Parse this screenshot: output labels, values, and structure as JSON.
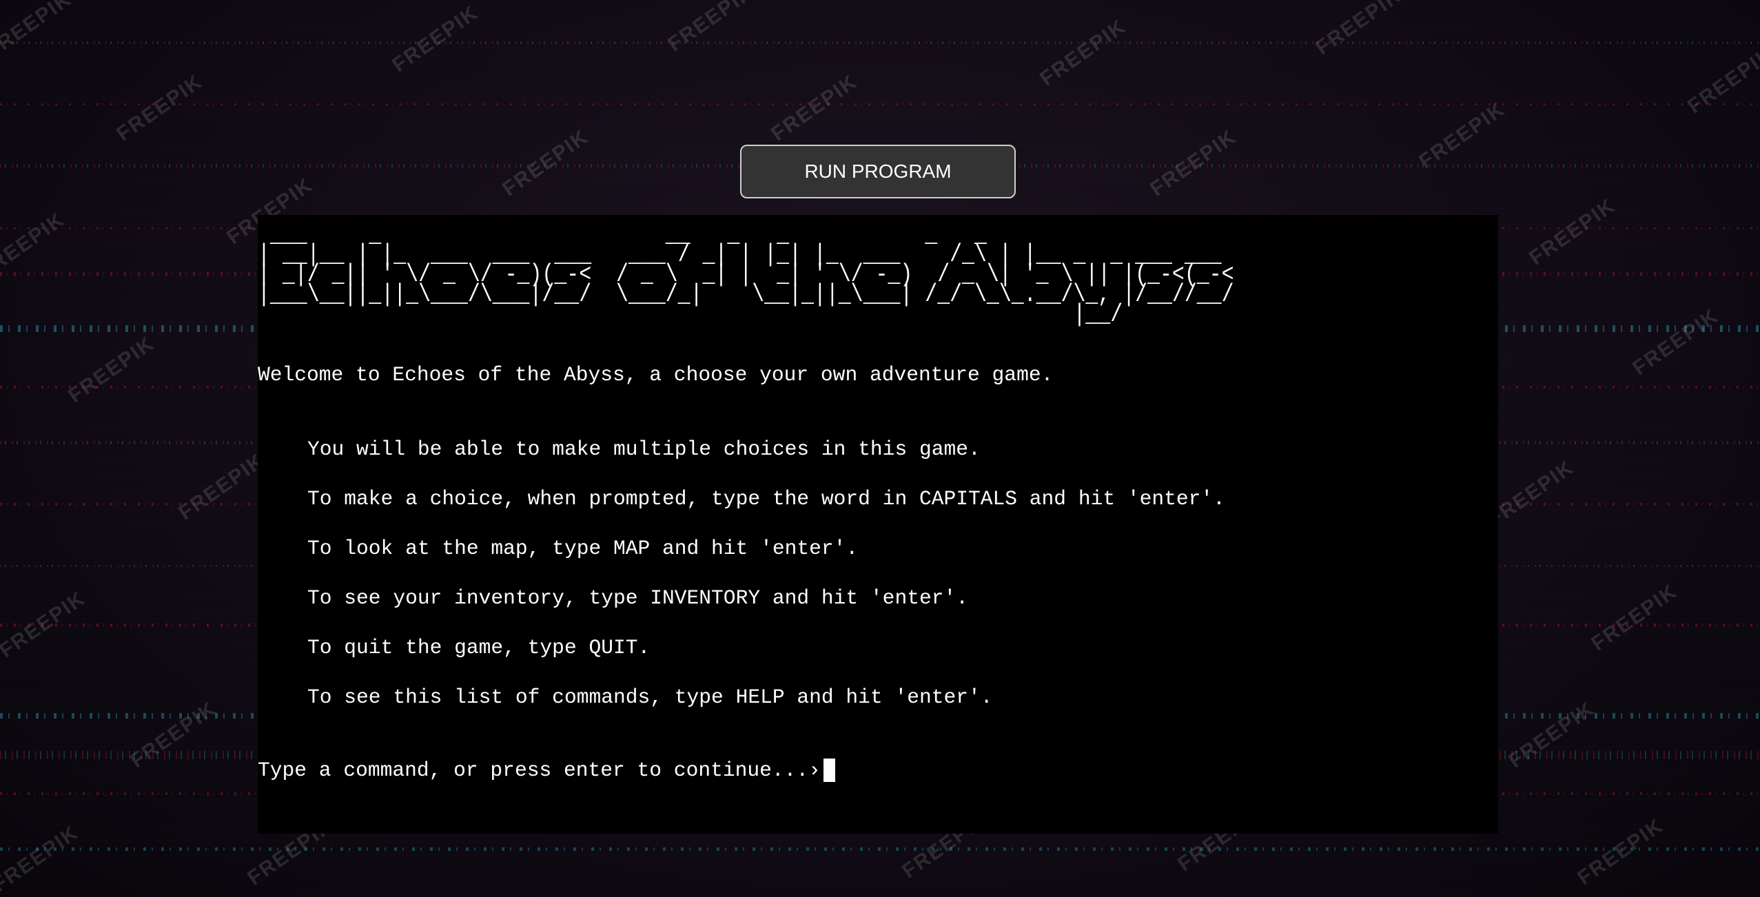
{
  "run_button": {
    "label": "RUN PROGRAM"
  },
  "watermark": {
    "text": "FREEPIK"
  },
  "terminal": {
    "ascii_title": " ___     _                       __   _   _           _   _               \n| __|__ | |_  ___  ___  ___   ___ / _| | |_| |_  ___    /_\\ | |__ _  _ ___ ___\n| _|/ _|| ' \\/ _ \\/ -_)(_-<  / _ \\  _| |  _| ' \\/ -_)  / _ \\| '_ \\ || |(_-<(_-<\n|___\\__||_||_\\___/\\___|/__/  \\___/_|    \\__|_||_\\___| /_/ \\_\\_.__/\\_, |/__//__/\n                                                                  |__/        ",
    "welcome": "Welcome to Echoes of the Abyss, a choose your own adventure game.",
    "instructions": [
      "You will be able to make multiple choices in this game.",
      "To make a choice, when prompted, type the word in CAPITALS and hit 'enter'.",
      "To look at the map, type MAP and hit 'enter'.",
      "To see your inventory, type INVENTORY and hit 'enter'.",
      "To quit the game, type QUIT.",
      "To see this list of commands, type HELP and hit 'enter'."
    ],
    "prompt": "Type a command, or press enter to continue...›"
  },
  "colors": {
    "terminal_bg": "#000000",
    "terminal_text": "#ffffff",
    "button_bg": "#333333",
    "page_bg": "#100a14"
  }
}
